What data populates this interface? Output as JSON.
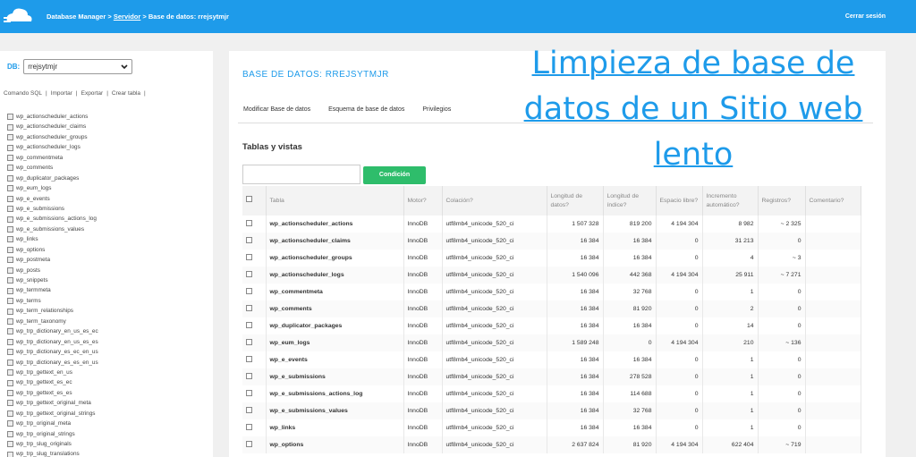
{
  "header": {
    "app": "Database Manager",
    "sep1": ">",
    "server": "Servidor",
    "sep2": ">",
    "db_crumb": "Base de datos: rrejsytmjr",
    "logout": "Cerrar sesión"
  },
  "sidebar": {
    "db_label": "DB:",
    "db_value": "rrejsytmjr",
    "actions": [
      "Comando SQL",
      "Importar",
      "Exportar",
      "Crear tabla"
    ],
    "action_sep": "|",
    "tables": [
      "wp_actionscheduler_actions",
      "wp_actionscheduler_claims",
      "wp_actionscheduler_groups",
      "wp_actionscheduler_logs",
      "wp_commentmeta",
      "wp_comments",
      "wp_duplicator_packages",
      "wp_eum_logs",
      "wp_e_events",
      "wp_e_submissions",
      "wp_e_submissions_actions_log",
      "wp_e_submissions_values",
      "wp_links",
      "wp_options",
      "wp_postmeta",
      "wp_posts",
      "wp_snippets",
      "wp_termmeta",
      "wp_terms",
      "wp_term_relationships",
      "wp_term_taxonomy",
      "wp_trp_dictionary_en_us_es_ec",
      "wp_trp_dictionary_en_us_es_es",
      "wp_trp_dictionary_es_ec_en_us",
      "wp_trp_dictionary_es_es_en_us",
      "wp_trp_gettext_en_us",
      "wp_trp_gettext_es_ec",
      "wp_trp_gettext_es_es",
      "wp_trp_gettext_original_meta",
      "wp_trp_gettext_original_strings",
      "wp_trp_original_meta",
      "wp_trp_original_strings",
      "wp_trp_slug_originals",
      "wp_trp_slug_translations"
    ]
  },
  "main": {
    "heading": "BASE DE DATOS: RREJSYTMJR",
    "tabs": [
      "Modificar Base de datos",
      "Esquema de base de datos",
      "Privilegios"
    ],
    "section_title": "Tablas y vistas",
    "filter_button": "Condición",
    "columns": [
      "Tabla",
      "Motor?",
      "Colación?",
      "Longitud de datos?",
      "Longitud de índice?",
      "Espacio libre?",
      "Incremento automático?",
      "Registros?",
      "Comentario?"
    ],
    "rows": [
      [
        "wp_actionscheduler_actions",
        "InnoDB",
        "utf8mb4_unicode_520_ci",
        "1 507 328",
        "819 200",
        "4 194 304",
        "8 982",
        "~ 2 325",
        ""
      ],
      [
        "wp_actionscheduler_claims",
        "InnoDB",
        "utf8mb4_unicode_520_ci",
        "16 384",
        "16 384",
        "0",
        "31 213",
        "0",
        ""
      ],
      [
        "wp_actionscheduler_groups",
        "InnoDB",
        "utf8mb4_unicode_520_ci",
        "16 384",
        "16 384",
        "0",
        "4",
        "~ 3",
        ""
      ],
      [
        "wp_actionscheduler_logs",
        "InnoDB",
        "utf8mb4_unicode_520_ci",
        "1 540 096",
        "442 368",
        "4 194 304",
        "25 911",
        "~ 7 271",
        ""
      ],
      [
        "wp_commentmeta",
        "InnoDB",
        "utf8mb4_unicode_520_ci",
        "16 384",
        "32 768",
        "0",
        "1",
        "0",
        ""
      ],
      [
        "wp_comments",
        "InnoDB",
        "utf8mb4_unicode_520_ci",
        "16 384",
        "81 920",
        "0",
        "2",
        "0",
        ""
      ],
      [
        "wp_duplicator_packages",
        "InnoDB",
        "utf8mb4_unicode_520_ci",
        "16 384",
        "16 384",
        "0",
        "14",
        "0",
        ""
      ],
      [
        "wp_eum_logs",
        "InnoDB",
        "utf8mb4_unicode_520_ci",
        "1 589 248",
        "0",
        "4 194 304",
        "210",
        "~ 136",
        ""
      ],
      [
        "wp_e_events",
        "InnoDB",
        "utf8mb4_unicode_520_ci",
        "16 384",
        "16 384",
        "0",
        "1",
        "0",
        ""
      ],
      [
        "wp_e_submissions",
        "InnoDB",
        "utf8mb4_unicode_520_ci",
        "16 384",
        "278 528",
        "0",
        "1",
        "0",
        ""
      ],
      [
        "wp_e_submissions_actions_log",
        "InnoDB",
        "utf8mb4_unicode_520_ci",
        "16 384",
        "114 688",
        "0",
        "1",
        "0",
        ""
      ],
      [
        "wp_e_submissions_values",
        "InnoDB",
        "utf8mb4_unicode_520_ci",
        "16 384",
        "32 768",
        "0",
        "1",
        "0",
        ""
      ],
      [
        "wp_links",
        "InnoDB",
        "utf8mb4_unicode_520_ci",
        "16 384",
        "16 384",
        "0",
        "1",
        "0",
        ""
      ],
      [
        "wp_options",
        "InnoDB",
        "utf8mb4_unicode_520_ci",
        "2 637 824",
        "81 920",
        "4 194 304",
        "622 404",
        "~ 719",
        ""
      ]
    ]
  },
  "overlay": {
    "line1": "Limpieza de base de",
    "line2": "datos de un Sitio web",
    "line3": "lento"
  },
  "colors": {
    "brand": "#1e9bea",
    "button": "#2ebd6b"
  },
  "icons": [
    "cloud-logo-icon",
    "chevron-down-icon",
    "table-icon",
    "checkbox-icon"
  ]
}
